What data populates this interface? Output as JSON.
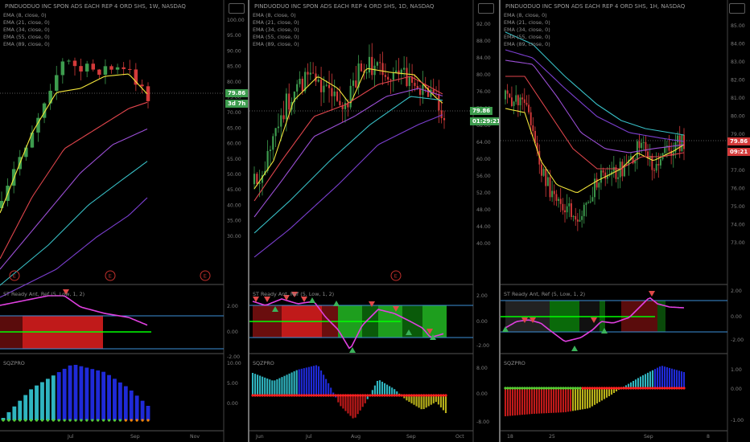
{
  "colors": {
    "up": "#3d9c4e",
    "down": "#d43a3a",
    "ema8": "#f2e53b",
    "ema21": "#e0454c",
    "ema34": "#9b4fd6",
    "ema55": "#38c0c7",
    "ema89": "#7b3fd0",
    "osc": "#e040e0",
    "band": "#3d8fd8",
    "zero": "#00ff00",
    "tag_green": "#3d9c4e",
    "tag_red": "#d43a3a"
  },
  "panels": [
    {
      "id": "weekly",
      "title": "PINDUODUO INC SPON ADS EACH REP 4 ORD SHS, 1W, NASDAQ",
      "ema_legend": [
        "EMA (8, close, 0)",
        "EMA (21, close, 0)",
        "EMA (34, close, 0)",
        "EMA (55, close, 0)",
        "EMA (89, close, 0)"
      ],
      "price_axis": [
        "100.00",
        "95.00",
        "90.00",
        "85.00",
        "80.00",
        "75.00",
        "70.00",
        "65.00",
        "60.00",
        "55.00",
        "50.00",
        "45.00",
        "40.00",
        "35.00",
        "30.00"
      ],
      "price_tags": [
        "79.86",
        "3d 7h"
      ],
      "osc_label": "ST Ready Ant, Ref (5, Low, 1, 2)",
      "osc_axis": [
        "2.00",
        "0.00",
        "-2.00"
      ],
      "mom_label": "SQZPRO",
      "mom_axis": [
        "10.00",
        "5.00",
        "0.00"
      ],
      "time_axis": [
        "Jul",
        "Sep",
        "Nov"
      ],
      "events": [
        "E",
        "E",
        "E"
      ]
    },
    {
      "id": "daily",
      "title": "PINDUODUO INC SPON ADS EACH REP 4 ORD SHS, 1D, NASDAQ",
      "ema_legend": [
        "EMA (8, close, 0)",
        "EMA (21, close, 0)",
        "EMA (34, close, 0)",
        "EMA (55, close, 0)",
        "EMA (89, close, 0)"
      ],
      "price_axis": [
        "92.00",
        "88.00",
        "84.00",
        "80.00",
        "76.00",
        "72.00",
        "68.00",
        "64.00",
        "60.00",
        "56.00",
        "52.00",
        "48.00",
        "44.00",
        "40.00"
      ],
      "price_tags": [
        "79.86",
        "01:29:21"
      ],
      "osc_label": "ST Ready Ant, Ref (5, Low, 1, 2)",
      "osc_axis": [
        "2.00",
        "0.00",
        "-2.00"
      ],
      "mom_label": "SQZPRO",
      "mom_axis": [
        "8.00",
        "0.00",
        "-8.00"
      ],
      "time_axis": [
        "Jun",
        "Jul",
        "Aug",
        "Sep",
        "Oct"
      ],
      "events": [
        "E"
      ]
    },
    {
      "id": "intraday",
      "title": "PINDUODUO INC SPON ADS EACH REP 4 ORD SHS, 1H, NASDAQ",
      "ema_legend": [
        "EMA (8, close, 0)",
        "EMA (21, close, 0)",
        "EMA (34, close, 0)",
        "EMA (55, close, 0)",
        "EMA (89, close, 0)"
      ],
      "price_axis": [
        "85.00",
        "84.00",
        "83.00",
        "82.00",
        "81.00",
        "80.00",
        "79.00",
        "78.00",
        "77.00",
        "76.00",
        "75.00",
        "74.00",
        "73.00"
      ],
      "price_tags": [
        "79.86",
        "09:21"
      ],
      "osc_label": "ST Ready Ant, Ref (5, Low, 1, 2)",
      "osc_axis": [
        "2.00",
        "0.00",
        "-2.00"
      ],
      "mom_label": "SQZPRO",
      "mom_axis": [
        "1.00",
        "0.00",
        "-1.00"
      ],
      "time_axis": [
        "18",
        "25",
        "Sep",
        "8"
      ],
      "events": []
    }
  ]
}
